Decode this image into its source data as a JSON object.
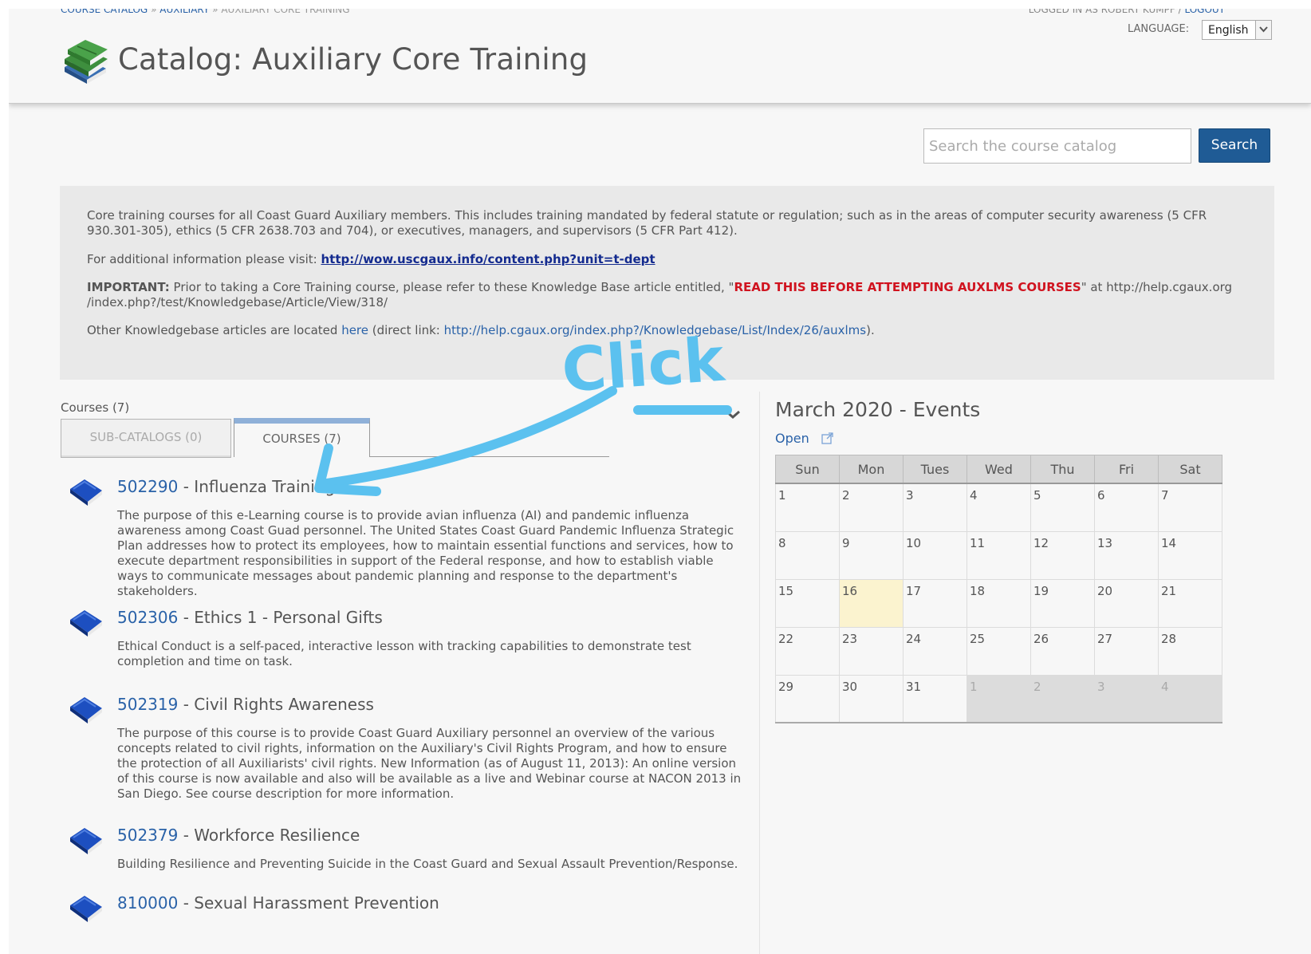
{
  "header": {
    "breadcrumb": {
      "items": [
        "COURSE CATALOG",
        "AUXILIARY",
        "AUXILIARY CORE TRAINING"
      ],
      "separator": "»"
    },
    "login_text": "LOGGED IN AS ROBERT KUMPF",
    "login_separator": "/",
    "logout_label": "LOGOUT",
    "language_label": "LANGUAGE:",
    "language_value": "English",
    "page_title": "Catalog: Auxiliary Core Training",
    "title_icon": "books-icon"
  },
  "search": {
    "placeholder": "Search the course catalog",
    "button_label": "Search"
  },
  "info": {
    "p1": "Core training courses for all Coast Guard Auxiliary members.  This includes training mandated by federal statute or regulation; such as in the areas of computer security awareness (5 CFR 930.301-305), ethics (5 CFR 2638.703 and 704), or executives, managers, and supervisors (5 CFR Part 412).",
    "p2_prefix": "For additional information please visit:",
    "p2_link": "http://wow.uscgaux.info/content.php?unit=t-dept",
    "p3_label": "IMPORTANT:",
    "p3_text1": " Prior to taking a Core Training course, please refer to these Knowledge Base article entitled, \"",
    "p3_red": "READ THIS BEFORE ATTEMPTING AUXLMS COURSES",
    "p3_text2": "\" at http://help.cgaux.org /index.php?/test/Knowledgebase/Article/View/318/",
    "p4_text1": "Other Knowledgebase articles are located ",
    "p4_here": "here",
    "p4_text2": " (direct link: ",
    "p4_link": "http://help.cgaux.org/index.php?/Knowledgebase/List/Index/26/auxlms",
    "p4_text3": ")."
  },
  "tabs": {
    "courses_count": "Courses (7)",
    "sub_catalogs": "SUB-CATALOGS (0)",
    "courses": "COURSES (7)"
  },
  "courses": [
    {
      "code": "502290",
      "title": " - Influenza Training",
      "description": "The purpose of this e-Learning course is to provide avian influenza (AI) and pandemic influenza awareness among Coast Guad personnel. The United States Coast Guard Pandemic Influenza Strategic Plan addresses how to protect its employees, how to maintain essential functions and services, how to execute department responsibilities in support of the Federal response, and how to establish viable ways to communicate messages about pandemic planning and response to the department's stakeholders."
    },
    {
      "code": "502306",
      "title": " - Ethics 1 - Personal Gifts",
      "description": "Ethical Conduct is a self-paced, interactive lesson with tracking capabilities to demonstrate test completion and time on task."
    },
    {
      "code": "502319",
      "title": " - Civil Rights Awareness",
      "description": "The purpose of this course is to provide Coast Guard Auxiliary personnel an overview of the various concepts related to civil rights, information on the Auxiliary's Civil Rights Program, and how to ensure the protection of all Auxiliarists' civil rights. New Information (as of August 11, 2013): An online version of this course is now available and also will be available as a live and Webinar course at NACON 2013 in San Diego. See course description for more information."
    },
    {
      "code": "502379",
      "title": " - Workforce Resilience",
      "description": "Building Resilience and Preventing Suicide in the Coast Guard and Sexual Assault Prevention/Response."
    },
    {
      "code": "810000",
      "title": " - Sexual Harassment Prevention",
      "description": ""
    }
  ],
  "calendar": {
    "title": "March 2020 - Events",
    "open_label": "Open",
    "days": [
      "Sun",
      "Mon",
      "Tues",
      "Wed",
      "Thu",
      "Fri",
      "Sat"
    ],
    "weeks": [
      [
        "1",
        "2",
        "3",
        "4",
        "5",
        "6",
        "7"
      ],
      [
        "8",
        "9",
        "10",
        "11",
        "12",
        "13",
        "14"
      ],
      [
        "15",
        "16",
        "17",
        "18",
        "19",
        "20",
        "21"
      ],
      [
        "22",
        "23",
        "24",
        "25",
        "26",
        "27",
        "28"
      ],
      [
        "29",
        "30",
        "31",
        "1",
        "2",
        "3",
        "4"
      ]
    ],
    "today": "16",
    "highlight_color": "#fbf3cf"
  },
  "annotation": {
    "text": "Click",
    "color": "#5bc1ef"
  },
  "colors": {
    "link": "#2a62a8",
    "search_button": "#1f5b95",
    "important_red": "#d0131f"
  }
}
